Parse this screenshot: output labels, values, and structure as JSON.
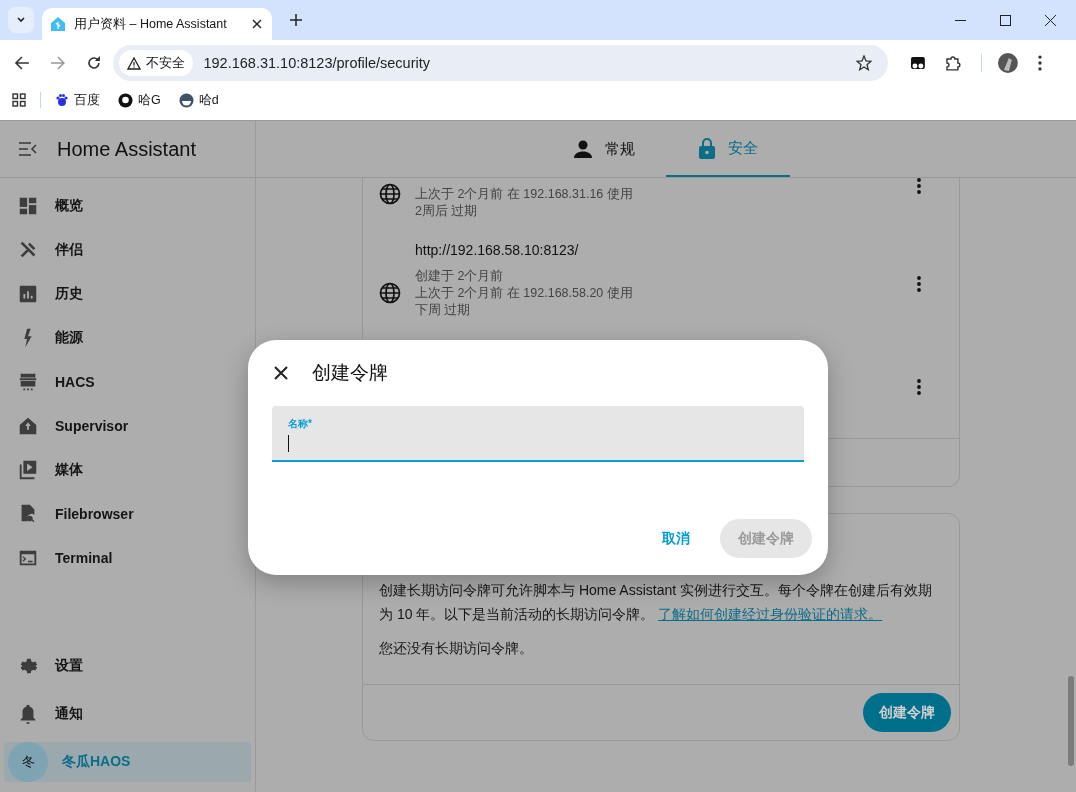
{
  "browser": {
    "tab_title": "用户资料 – Home Assistant",
    "security_label": "不安全",
    "url": "192.168.31.10:8123/profile/security",
    "bookmarks": [
      {
        "label": "百度"
      },
      {
        "label": "哈G"
      },
      {
        "label": "哈d"
      }
    ]
  },
  "sidebar": {
    "title": "Home Assistant",
    "items": [
      {
        "label": "概览",
        "selected": false
      },
      {
        "label": "伴侣",
        "selected": false
      },
      {
        "label": "历史",
        "selected": false
      },
      {
        "label": "能源",
        "selected": false
      },
      {
        "label": "HACS",
        "selected": false
      },
      {
        "label": "Supervisor",
        "selected": false
      },
      {
        "label": "媒体",
        "selected": false
      },
      {
        "label": "Filebrowser",
        "selected": false
      },
      {
        "label": "Terminal",
        "selected": false
      }
    ],
    "bottom_items": [
      {
        "label": "设置",
        "selected": false
      },
      {
        "label": "通知",
        "selected": false
      }
    ],
    "user": {
      "initial": "冬",
      "name": "冬瓜HAOS",
      "selected": true
    }
  },
  "tabs": [
    {
      "label": "常规",
      "selected": false
    },
    {
      "label": "安全",
      "selected": true
    }
  ],
  "sessions": [
    {
      "menu": true,
      "lines": [
        "上次于 2个月前 在 192.168.31.16 使用",
        "2周后 过期"
      ]
    },
    {
      "menu": true,
      "url": "http://192.168.58.10:8123/",
      "lines": [
        "创建于 2个月前",
        "上次于 2个月前 在 192.168.58.20 使用",
        "下周 过期"
      ]
    },
    {
      "menu": true
    }
  ],
  "token_card": {
    "description": "创建长期访问令牌可允许脚本与 Home Assistant 实例进行交互。每个令牌在创建后有效期为 10 年。以下是当前活动的长期访问令牌。",
    "link": "了解如何创建经过身份验证的请求。",
    "empty_text": "您还没有长期访问令牌。",
    "button": "创建令牌"
  },
  "dialog": {
    "title": "创建令牌",
    "field": {
      "label": "名称*",
      "focused": true
    },
    "cancel": "取消",
    "confirm": {
      "label": "创建令牌",
      "disabled": true
    }
  }
}
